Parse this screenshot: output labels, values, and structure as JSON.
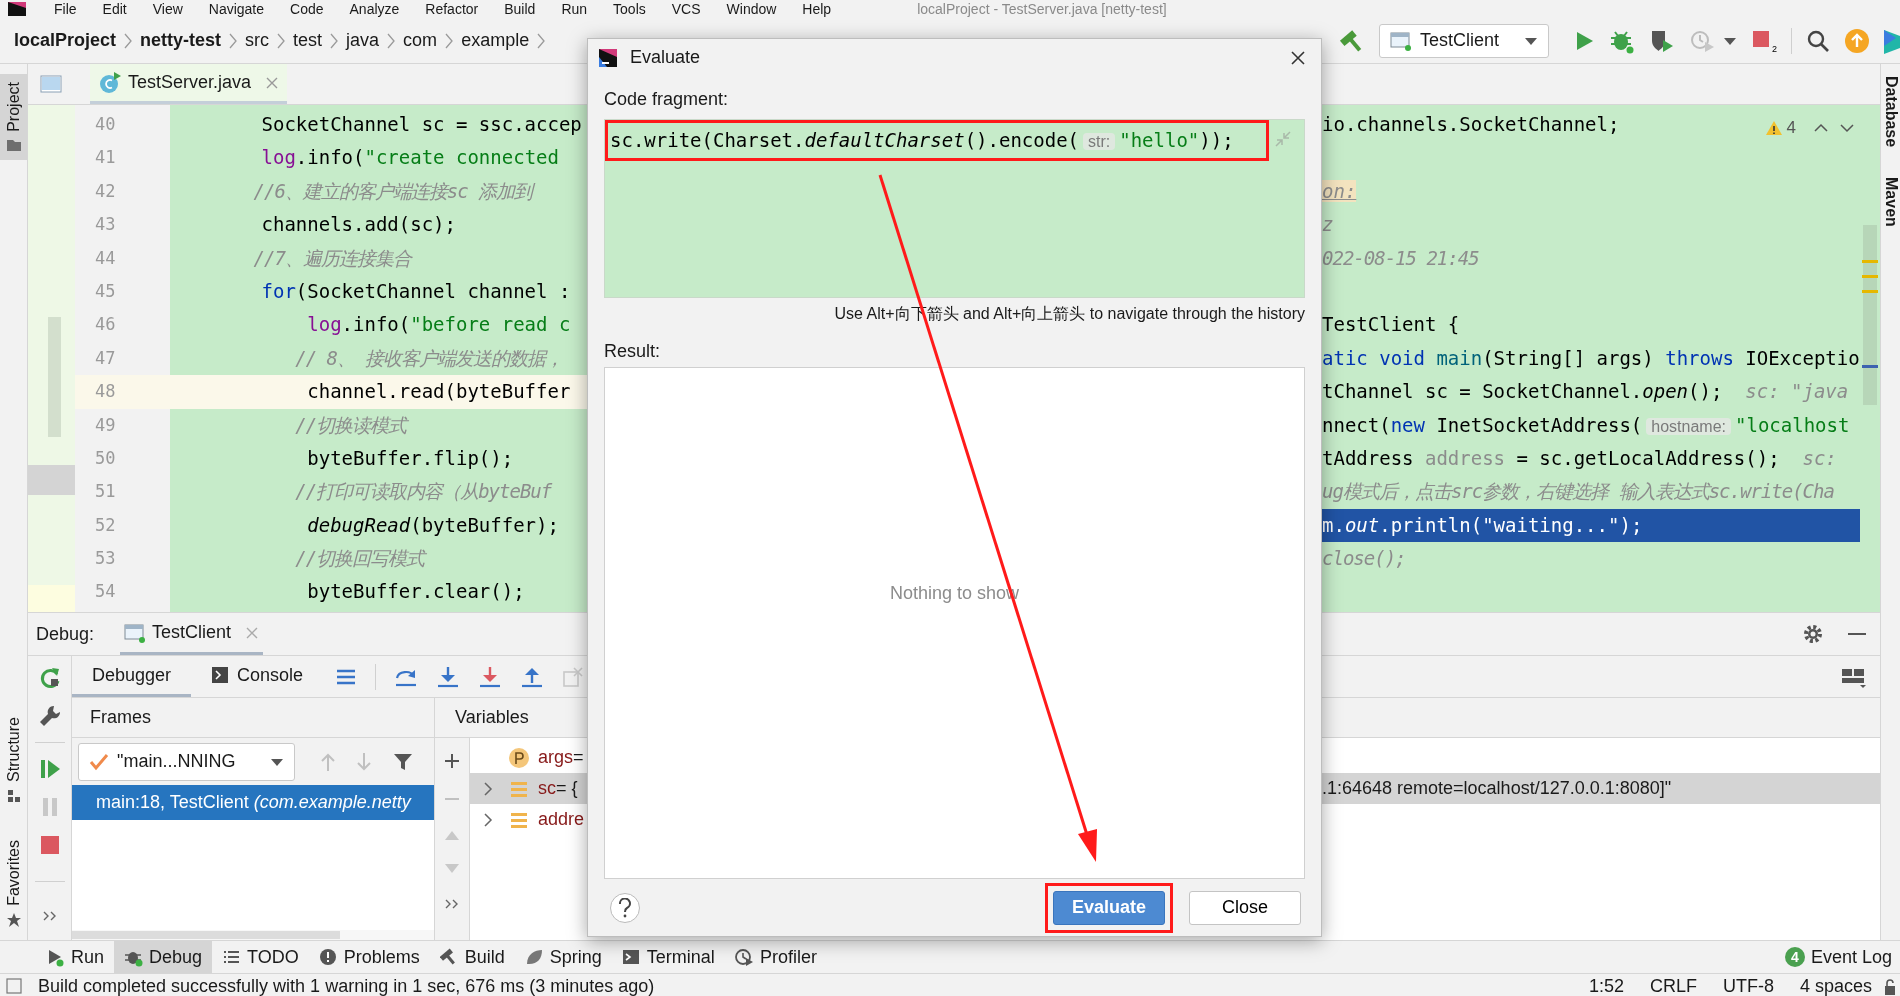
{
  "menu": [
    "File",
    "Edit",
    "View",
    "Navigate",
    "Code",
    "Analyze",
    "Refactor",
    "Build",
    "Run",
    "Tools",
    "VCS",
    "Window",
    "Help"
  ],
  "window_title": "localProject - TestServer.java [netty-test]",
  "breadcrumbs": [
    {
      "label": "localProject",
      "bold": true
    },
    {
      "label": "netty-test",
      "bold": true
    },
    {
      "label": "src",
      "bold": false
    },
    {
      "label": "test",
      "bold": false
    },
    {
      "label": "java",
      "bold": false
    },
    {
      "label": "com",
      "bold": false
    },
    {
      "label": "example",
      "bold": false
    }
  ],
  "run_config": "TestClient",
  "stop_count": "2",
  "left_stripe": {
    "top": [
      {
        "label": "Project",
        "selected": true
      }
    ],
    "bottom": [
      {
        "label": "Structure",
        "selected": false
      },
      {
        "label": "Favorites",
        "selected": false
      }
    ]
  },
  "right_stripe": [
    "Database",
    "Maven"
  ],
  "editor": {
    "tabs": [
      {
        "label": "TestServer.java",
        "selected": true
      }
    ],
    "warning_count": "4",
    "lines": [
      {
        "number": "40",
        "current": false,
        "execution_point": false,
        "left": [
          {
            "text": "        SocketChannel sc = ssc.accep",
            "kind": "plain"
          }
        ],
        "right": [
          {
            "text": "io.channels.SocketChannel;",
            "kind": "plain"
          }
        ]
      },
      {
        "number": "41",
        "current": false,
        "execution_point": false,
        "left": [
          {
            "text": "        log",
            "kind": "field"
          },
          {
            "text": ".info(",
            "kind": "plain"
          },
          {
            "text": "\"create connected",
            "kind": "string"
          }
        ]
      },
      {
        "number": "42",
        "current": false,
        "execution_point": false,
        "left": [
          {
            "text": "        //6、建立的客户端连接sc 添加到",
            "kind": "comment"
          }
        ],
        "right": [
          {
            "text": "on:",
            "kind": "doc"
          }
        ]
      },
      {
        "number": "43",
        "current": false,
        "execution_point": false,
        "left": [
          {
            "text": "        channels.add(sc);",
            "kind": "plain"
          }
        ],
        "right": [
          {
            "text": "z",
            "kind": "comment"
          }
        ]
      },
      {
        "number": "44",
        "current": false,
        "execution_point": false,
        "left": [
          {
            "text": "        //7、遍历连接集合",
            "kind": "comment"
          }
        ],
        "right": [
          {
            "text": "022-08-15 21:45",
            "kind": "comment"
          }
        ]
      },
      {
        "number": "45",
        "current": false,
        "execution_point": false,
        "left": [
          {
            "text": "        for",
            "kind": "keyword"
          },
          {
            "text": "(SocketChannel channel :",
            "kind": "plain"
          }
        ]
      },
      {
        "number": "46",
        "current": false,
        "execution_point": false,
        "left": [
          {
            "text": "            log",
            "kind": "field"
          },
          {
            "text": ".info(",
            "kind": "plain"
          },
          {
            "text": "\"before read c",
            "kind": "string"
          }
        ],
        "right": [
          {
            "text": "TestClient {",
            "kind": "plain"
          }
        ]
      },
      {
        "number": "47",
        "current": false,
        "execution_point": false,
        "left": [
          {
            "text": "            // 8、 接收客户端发送的数据，",
            "kind": "comment"
          }
        ],
        "right": [
          {
            "text": "atic void ",
            "kind": "keyword"
          },
          {
            "text": "main",
            "kind": "method"
          },
          {
            "text": "(String[] args) ",
            "kind": "plain"
          },
          {
            "text": "throws",
            "kind": "keyword"
          },
          {
            "text": " IOExceptio",
            "kind": "plain"
          }
        ]
      },
      {
        "number": "48",
        "current": true,
        "execution_point": false,
        "left": [
          {
            "text": "            channel.read(byteBuffer",
            "kind": "plain"
          }
        ],
        "right": [
          {
            "text": "tChannel sc = SocketChannel.",
            "kind": "plain"
          },
          {
            "text": "open",
            "kind": "static"
          },
          {
            "text": "();",
            "kind": "plain"
          },
          {
            "text": "  sc: \"java",
            "kind": "inline"
          }
        ]
      },
      {
        "number": "49",
        "current": false,
        "execution_point": false,
        "left": [
          {
            "text": "            //切换读模式",
            "kind": "comment"
          }
        ],
        "right": [
          {
            "text": "nnect(",
            "kind": "plain"
          },
          {
            "text": "new",
            "kind": "keyword"
          },
          {
            "text": " InetSocketAddress(",
            "kind": "plain"
          },
          {
            "text": "hostname:",
            "kind": "hint"
          },
          {
            "text": "\"localhost",
            "kind": "string"
          }
        ]
      },
      {
        "number": "50",
        "current": false,
        "execution_point": false,
        "left": [
          {
            "text": "            byteBuffer.flip();",
            "kind": "plain"
          }
        ],
        "right": [
          {
            "text": "tAddress ",
            "kind": "plain"
          },
          {
            "text": "address",
            "kind": "unused"
          },
          {
            "text": " = sc.getLocalAddress();",
            "kind": "plain"
          },
          {
            "text": "  sc:",
            "kind": "inline"
          }
        ]
      },
      {
        "number": "51",
        "current": false,
        "execution_point": false,
        "left": [
          {
            "text": "            //打印可读取内容（从byteBuf",
            "kind": "comment"
          }
        ],
        "right": [
          {
            "text": "ug模式后，点击src参数，右键选择 输入表达式sc.write(Cha",
            "kind": "comment"
          }
        ]
      },
      {
        "number": "52",
        "current": false,
        "execution_point": true,
        "left": [
          {
            "text": "            debugRead",
            "kind": "static"
          },
          {
            "text": "(byteBuffer);",
            "kind": "plain"
          }
        ],
        "right": [
          {
            "text": "m.",
            "kind": "plain"
          },
          {
            "text": "out",
            "kind": "static"
          },
          {
            "text": ".println(\"waiting...\");",
            "kind": "plain"
          }
        ]
      },
      {
        "number": "53",
        "current": false,
        "execution_point": false,
        "left": [
          {
            "text": "            //切换回写模式",
            "kind": "comment"
          }
        ],
        "right": [
          {
            "text": "close();",
            "kind": "comment"
          }
        ]
      },
      {
        "number": "54",
        "current": false,
        "execution_point": false,
        "left": [
          {
            "text": "            byteBuffer.clear();",
            "kind": "plain"
          }
        ]
      }
    ]
  },
  "debug": {
    "title": "Debug:",
    "session_tab": {
      "label": "TestClient",
      "selected": true
    },
    "tabs": [
      {
        "label": "Debugger",
        "kind": "plain",
        "selected": true
      },
      {
        "label": "Console",
        "kind": "console",
        "selected": false
      }
    ],
    "frames": {
      "title": "Frames",
      "thread": "\"main...NNING",
      "items": [
        {
          "text": "main:18, TestClient *(com.example.netty*",
          "selected": true
        }
      ]
    },
    "variables": {
      "title": "Variables",
      "items": [
        {
          "kind": "param",
          "name": "args",
          "value": " =",
          "expandable": false,
          "selected": false
        },
        {
          "kind": "field",
          "name": "sc",
          "value": " = {",
          "tail": ".1:64648 remote=localhost/127.0.0.1:8080]\"",
          "expandable": true,
          "selected": true
        },
        {
          "kind": "field",
          "name": "addre",
          "expandable": true,
          "selected": false
        }
      ]
    }
  },
  "dialog": {
    "title": "Evaluate",
    "code_label": "Code fragment:",
    "code": [
      {
        "text": "sc.write(Charset.",
        "kind": "plain"
      },
      {
        "text": "defaultCharset",
        "kind": "static"
      },
      {
        "text": "().encode(",
        "kind": "plain"
      },
      {
        "text": "str:",
        "kind": "hint"
      },
      {
        "text": "\"hello\"",
        "kind": "string"
      },
      {
        "text": "));",
        "kind": "plain"
      }
    ],
    "history_hint": "Use Alt+向下箭头 and Alt+向上箭头 to navigate through the history",
    "result_label": "Result:",
    "result_empty": "Nothing to show",
    "buttons": [
      {
        "label": "Evaluate",
        "kind": "primary",
        "highlighted": true
      },
      {
        "label": "Close",
        "kind": "secondary",
        "highlighted": false
      }
    ]
  },
  "tool_windows": [
    {
      "label": "Run",
      "kind": "run",
      "selected": false
    },
    {
      "label": "Debug",
      "kind": "debug",
      "selected": true
    },
    {
      "label": "TODO",
      "kind": "todo",
      "selected": false
    },
    {
      "label": "Problems",
      "kind": "problems",
      "selected": false
    },
    {
      "label": "Build",
      "kind": "build",
      "selected": false
    },
    {
      "label": "Spring",
      "kind": "spring",
      "selected": false
    },
    {
      "label": "Terminal",
      "kind": "terminal",
      "selected": false
    },
    {
      "label": "Profiler",
      "kind": "profiler",
      "selected": false
    }
  ],
  "event_log": {
    "label": "Event Log",
    "count": "4"
  },
  "status_bar": {
    "message": "Build completed successfully with 1 warning in 1 sec, 676 ms (3 minutes ago)",
    "items": [
      "1:52",
      "CRLF",
      "UTF-8",
      "4 spaces"
    ]
  }
}
